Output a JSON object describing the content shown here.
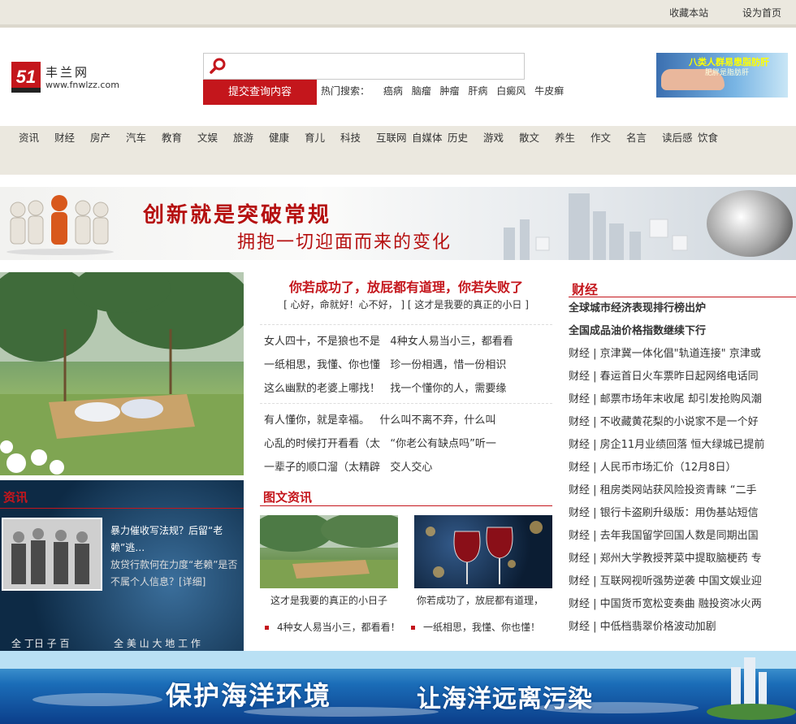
{
  "topbar": {
    "bookmark": "收藏本站",
    "set_home": "设为首页"
  },
  "logo": {
    "mark": "51",
    "name": "丰兰网",
    "url": "www.fnwlzz.com"
  },
  "search": {
    "placeholder": "",
    "submit": "提交查询内容"
  },
  "hot": {
    "label": "热门搜索：",
    "keywords": [
      "癌病",
      "脑瘤",
      "肿瘤",
      "肝病",
      "白癜风",
      "牛皮癣"
    ]
  },
  "ad_top": {
    "line1": "八类人群易患脂肪肝",
    "line2": "肥胖是脂肪肝"
  },
  "nav": [
    "资讯",
    "财经",
    "房产",
    "汽车",
    "教育",
    "文娱",
    "旅游",
    "健康",
    "育儿",
    "科技",
    "互联网",
    "自媒体",
    "历史",
    "游戏",
    "散文",
    "养生",
    "作文",
    "名言",
    "读后感",
    "饮食"
  ],
  "banner1": {
    "title": "创新就是突破常规",
    "subtitle": "拥抱一切迎面而来的变化"
  },
  "zixun": {
    "heading": "资讯",
    "thumb_caption": "",
    "text_title": "暴力催收写法规？后留“老赖”逃…",
    "text_body": "放贷行款何在力度“老赖”是否不属个人信息？[详细]",
    "detail": "[详细]",
    "foot_left": "全 丁日 子 百",
    "foot_right": "全 美 山 大 地 工 作"
  },
  "center": {
    "title": "你若成功了，放屁都有道理，你若失败了",
    "sub": "[ 心好，命就好！心不好， ] [ 这才是我要的真正的小日 ]",
    "p1": [
      "女人四十，不是狼也不是",
      "4种女人易当小三，都看看",
      "一纸相思，我懂、你也懂",
      "珍一份相遇，惜一份相识",
      "这么幽默的老婆上哪找！",
      "找一个懂你的人，需要缘"
    ],
    "p2": [
      "有人懂你，就是幸福。",
      "什么叫不离不弃，什么叫",
      "心乱的时候打开看看（太",
      "“你老公有缺点吗”听一",
      "一辈子的顺口溜（太精辟",
      "交人交心"
    ]
  },
  "tuwen": {
    "heading": "图文资讯",
    "items": [
      {
        "caption": "这才是我要的真正的小日子",
        "link": "4种女人易当小三，都看看！"
      },
      {
        "caption": "你若成功了，放屁都有道理，",
        "link": "一纸相思，我懂、你也懂！"
      }
    ]
  },
  "caijing": {
    "heading": "财经",
    "headlines": [
      "全球城市经济表现排行榜出炉",
      "全国成品油价格指数继续下行"
    ],
    "list": [
      "财经 | 京津冀一体化倡\"轨道连接\" 京津或",
      "财经 | 春运首日火车票昨日起网络电话同",
      "财经 | 邮票市场年末收尾 却引发抢购风潮",
      "财经 | 不收藏黄花梨的小说家不是一个好",
      "财经 | 房企11月业绩回落 恒大绿城已提前",
      "财经 | 人民币市场汇价（12月8日）",
      "财经 | 租房类网站获风险投资青睐 “二手",
      "财经 | 银行卡盗刷升级版：用伪基站短信",
      "财经 | 去年我国留学回国人数是同期出国",
      "财经 | 郑州大学教授荠菜中提取脑梗药 专",
      "财经 | 互联网视听强势逆袭 中国文娱业迎",
      "财经 | 中国货币宽松变奏曲 融投资冰火两",
      "财经 | 中低档翡翠价格波动加剧"
    ]
  },
  "bottom_banner": {
    "left": "保护海洋环境",
    "right": "让海洋远离污染"
  }
}
